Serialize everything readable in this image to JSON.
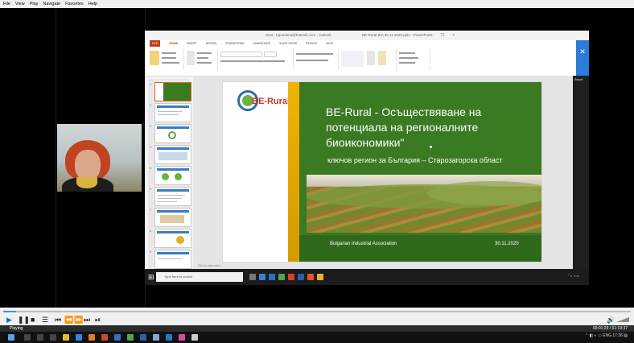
{
  "player": {
    "menu": [
      "File",
      "View",
      "Play",
      "Navigate",
      "Favorites",
      "Help"
    ],
    "status": "Playing",
    "time_readout": "00:01:29 / 01:19:37",
    "volume_icon": "speaker-icon"
  },
  "ppt": {
    "window_title": "Sent - bquedena@hotmail.com - Outlook",
    "doc_title": "BE-Rural BIA 30.11.2020.pptx - PowerPoint",
    "tabs": [
      "FILE",
      "HOME",
      "INSERT",
      "DESIGN",
      "TRANSITIONS",
      "ANIMATIONS",
      "SLIDE SHOW",
      "REVIEW",
      "VIEW"
    ],
    "active_tab": "HOME",
    "side_panel_label": "Report",
    "notes_placeholder": "Click to add notes",
    "thumbnail_numbers": [
      "1",
      "2",
      "3",
      "4",
      "5",
      "6",
      "7",
      "8",
      "9"
    ]
  },
  "slide": {
    "logo_text": "BE-Rural",
    "title": "BE-Rural - Осъществяване на потенциала на регионалните биоикономики\"",
    "subtitle": "ключов регион за България – Старозагорска област",
    "organization": "Bulgarian Industrial Association",
    "date": "30.11.2020"
  },
  "shared_taskbar": {
    "search_placeholder": "Type here to search"
  },
  "taskbar": {
    "tray_lang": "ENG",
    "tray_time": "17:36"
  },
  "colors": {
    "slide_green": "#3a7a23",
    "slide_gold": "#f0b400",
    "ppt_accent": "#c43e1c",
    "close_blue": "#2b7bd8"
  },
  "progress": {
    "seek_fraction": 0.02
  }
}
